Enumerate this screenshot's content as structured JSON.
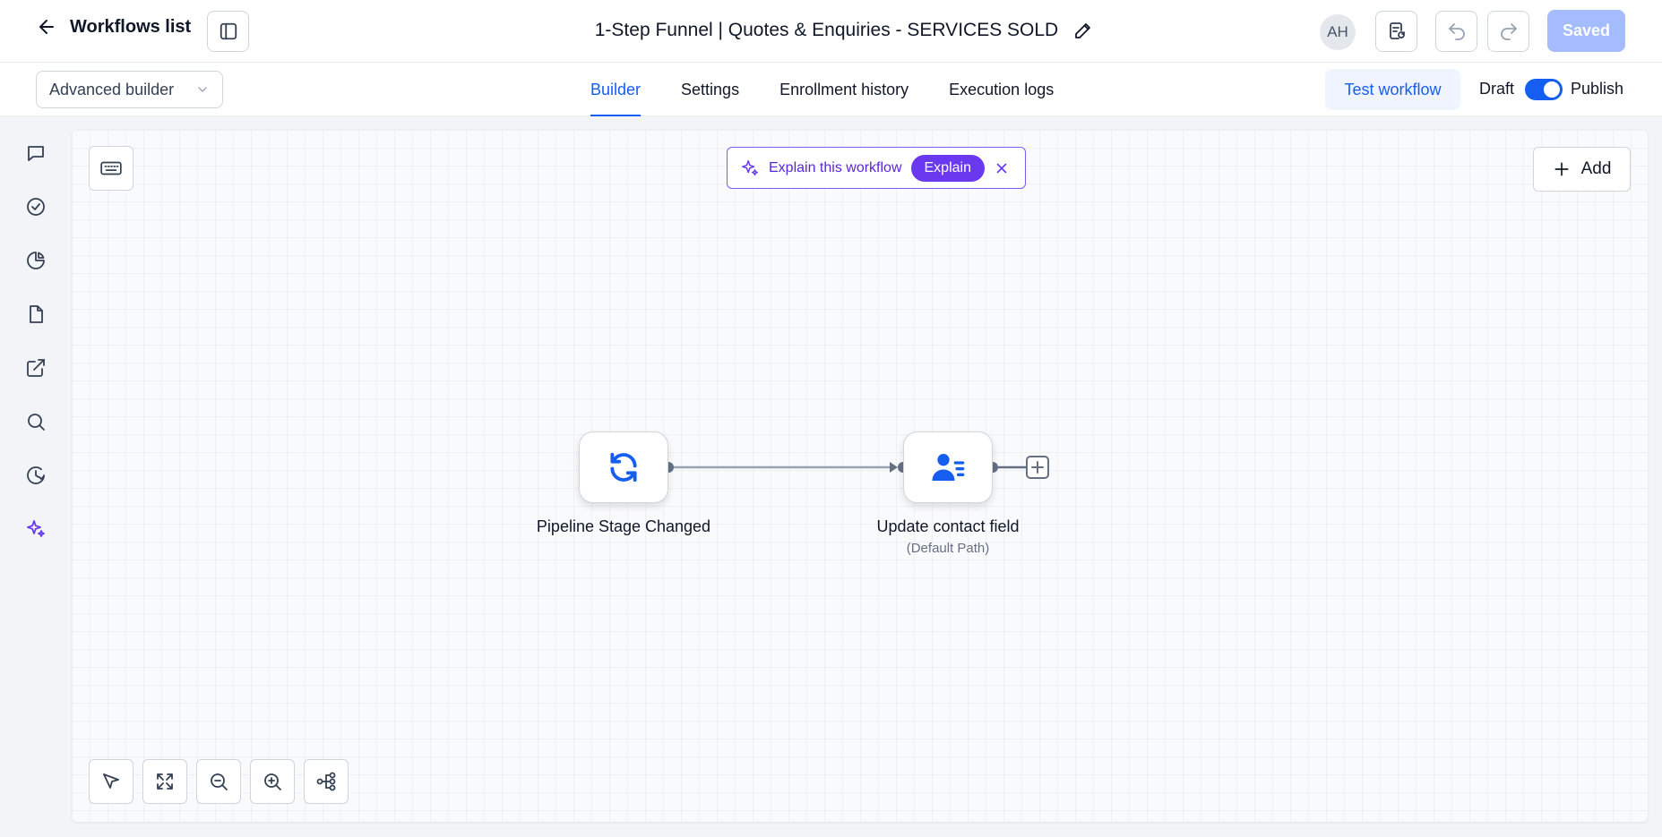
{
  "header": {
    "back_label": "Workflows list",
    "workflow_title": "1-Step Funnel | Quotes & Enquiries - SERVICES SOLD",
    "avatar_initials": "AH",
    "saved_label": "Saved"
  },
  "subbar": {
    "builder_mode": "Advanced builder",
    "tabs": [
      {
        "label": "Builder",
        "active": true
      },
      {
        "label": "Settings",
        "active": false
      },
      {
        "label": "Enrollment history",
        "active": false
      },
      {
        "label": "Execution logs",
        "active": false
      }
    ],
    "test_label": "Test workflow",
    "draft_label": "Draft",
    "publish_label": "Publish",
    "published": true
  },
  "sidebar": {
    "icons": [
      "chat-icon",
      "check-circle-icon",
      "pie-chart-icon",
      "file-icon",
      "external-link-icon",
      "search-icon",
      "history-icon",
      "sparkle-icon"
    ]
  },
  "canvas": {
    "explain_text": "Explain this workflow",
    "explain_button": "Explain",
    "add_label": "Add",
    "nodes": [
      {
        "label": "Pipeline Stage Changed",
        "sublabel": "",
        "icon": "refresh-icon"
      },
      {
        "label": "Update contact field",
        "sublabel": "(Default Path)",
        "icon": "contact-field-icon"
      }
    ]
  },
  "colors": {
    "primary": "#155eef",
    "ai_purple": "#6938ef",
    "saved_disabled": "#a4bcfd"
  }
}
